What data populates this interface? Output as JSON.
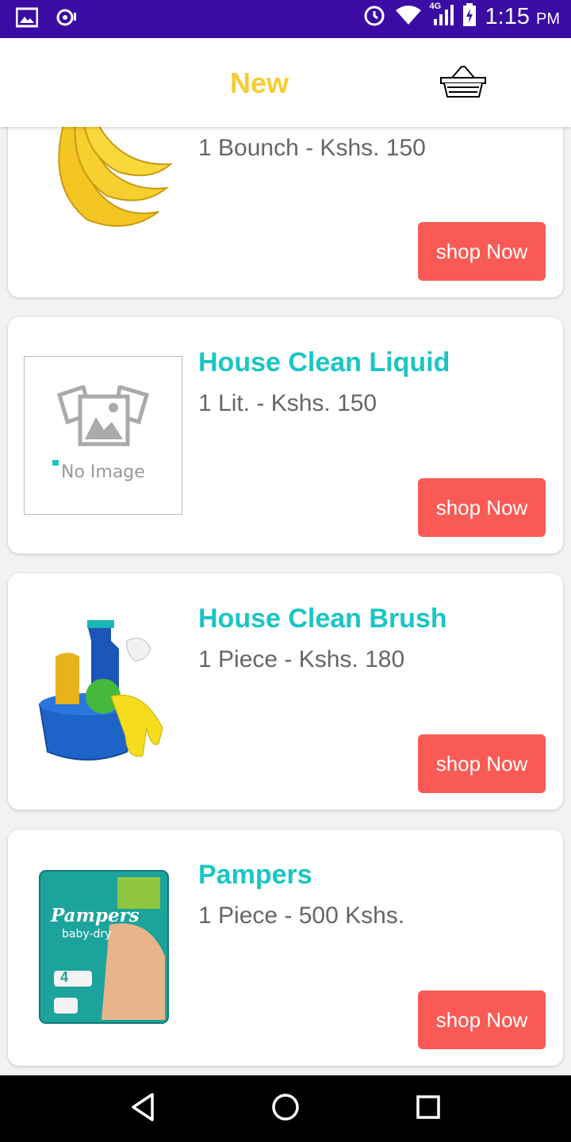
{
  "status_bar": {
    "time": "1:15",
    "ampm": "PM",
    "network": "4G",
    "icons": [
      "image-icon",
      "location-icon",
      "alarm-icon",
      "wifi-icon",
      "signal-icon",
      "battery-icon"
    ]
  },
  "app_bar": {
    "title": "New",
    "cart_icon": "basket-icon"
  },
  "colors": {
    "status_bar": "#3a0ca3",
    "title": "#f5cd2e",
    "product_name": "#19c6c3",
    "button": "#fa5a55"
  },
  "products": [
    {
      "name": "",
      "desc": "1 Bounch - Kshs. 150",
      "button": "shop Now",
      "image": "banana"
    },
    {
      "name": "House Clean Liquid",
      "desc": "1 Lit. - Kshs. 150",
      "button": "shop Now",
      "image": "no-image",
      "placeholder": "No Image"
    },
    {
      "name": "House Clean Brush",
      "desc": "1 Piece - Kshs. 180",
      "button": "shop Now",
      "image": "cleaning-bucket"
    },
    {
      "name": "Pampers",
      "desc": "1 Piece - 500 Kshs.",
      "button": "shop Now",
      "image": "pampers-pack",
      "pack_brand": "Pampers",
      "pack_sub": "baby-dry",
      "pack_size": "4"
    }
  ],
  "nav_bar": {
    "icons": [
      "back-icon",
      "home-icon",
      "recents-icon"
    ]
  }
}
